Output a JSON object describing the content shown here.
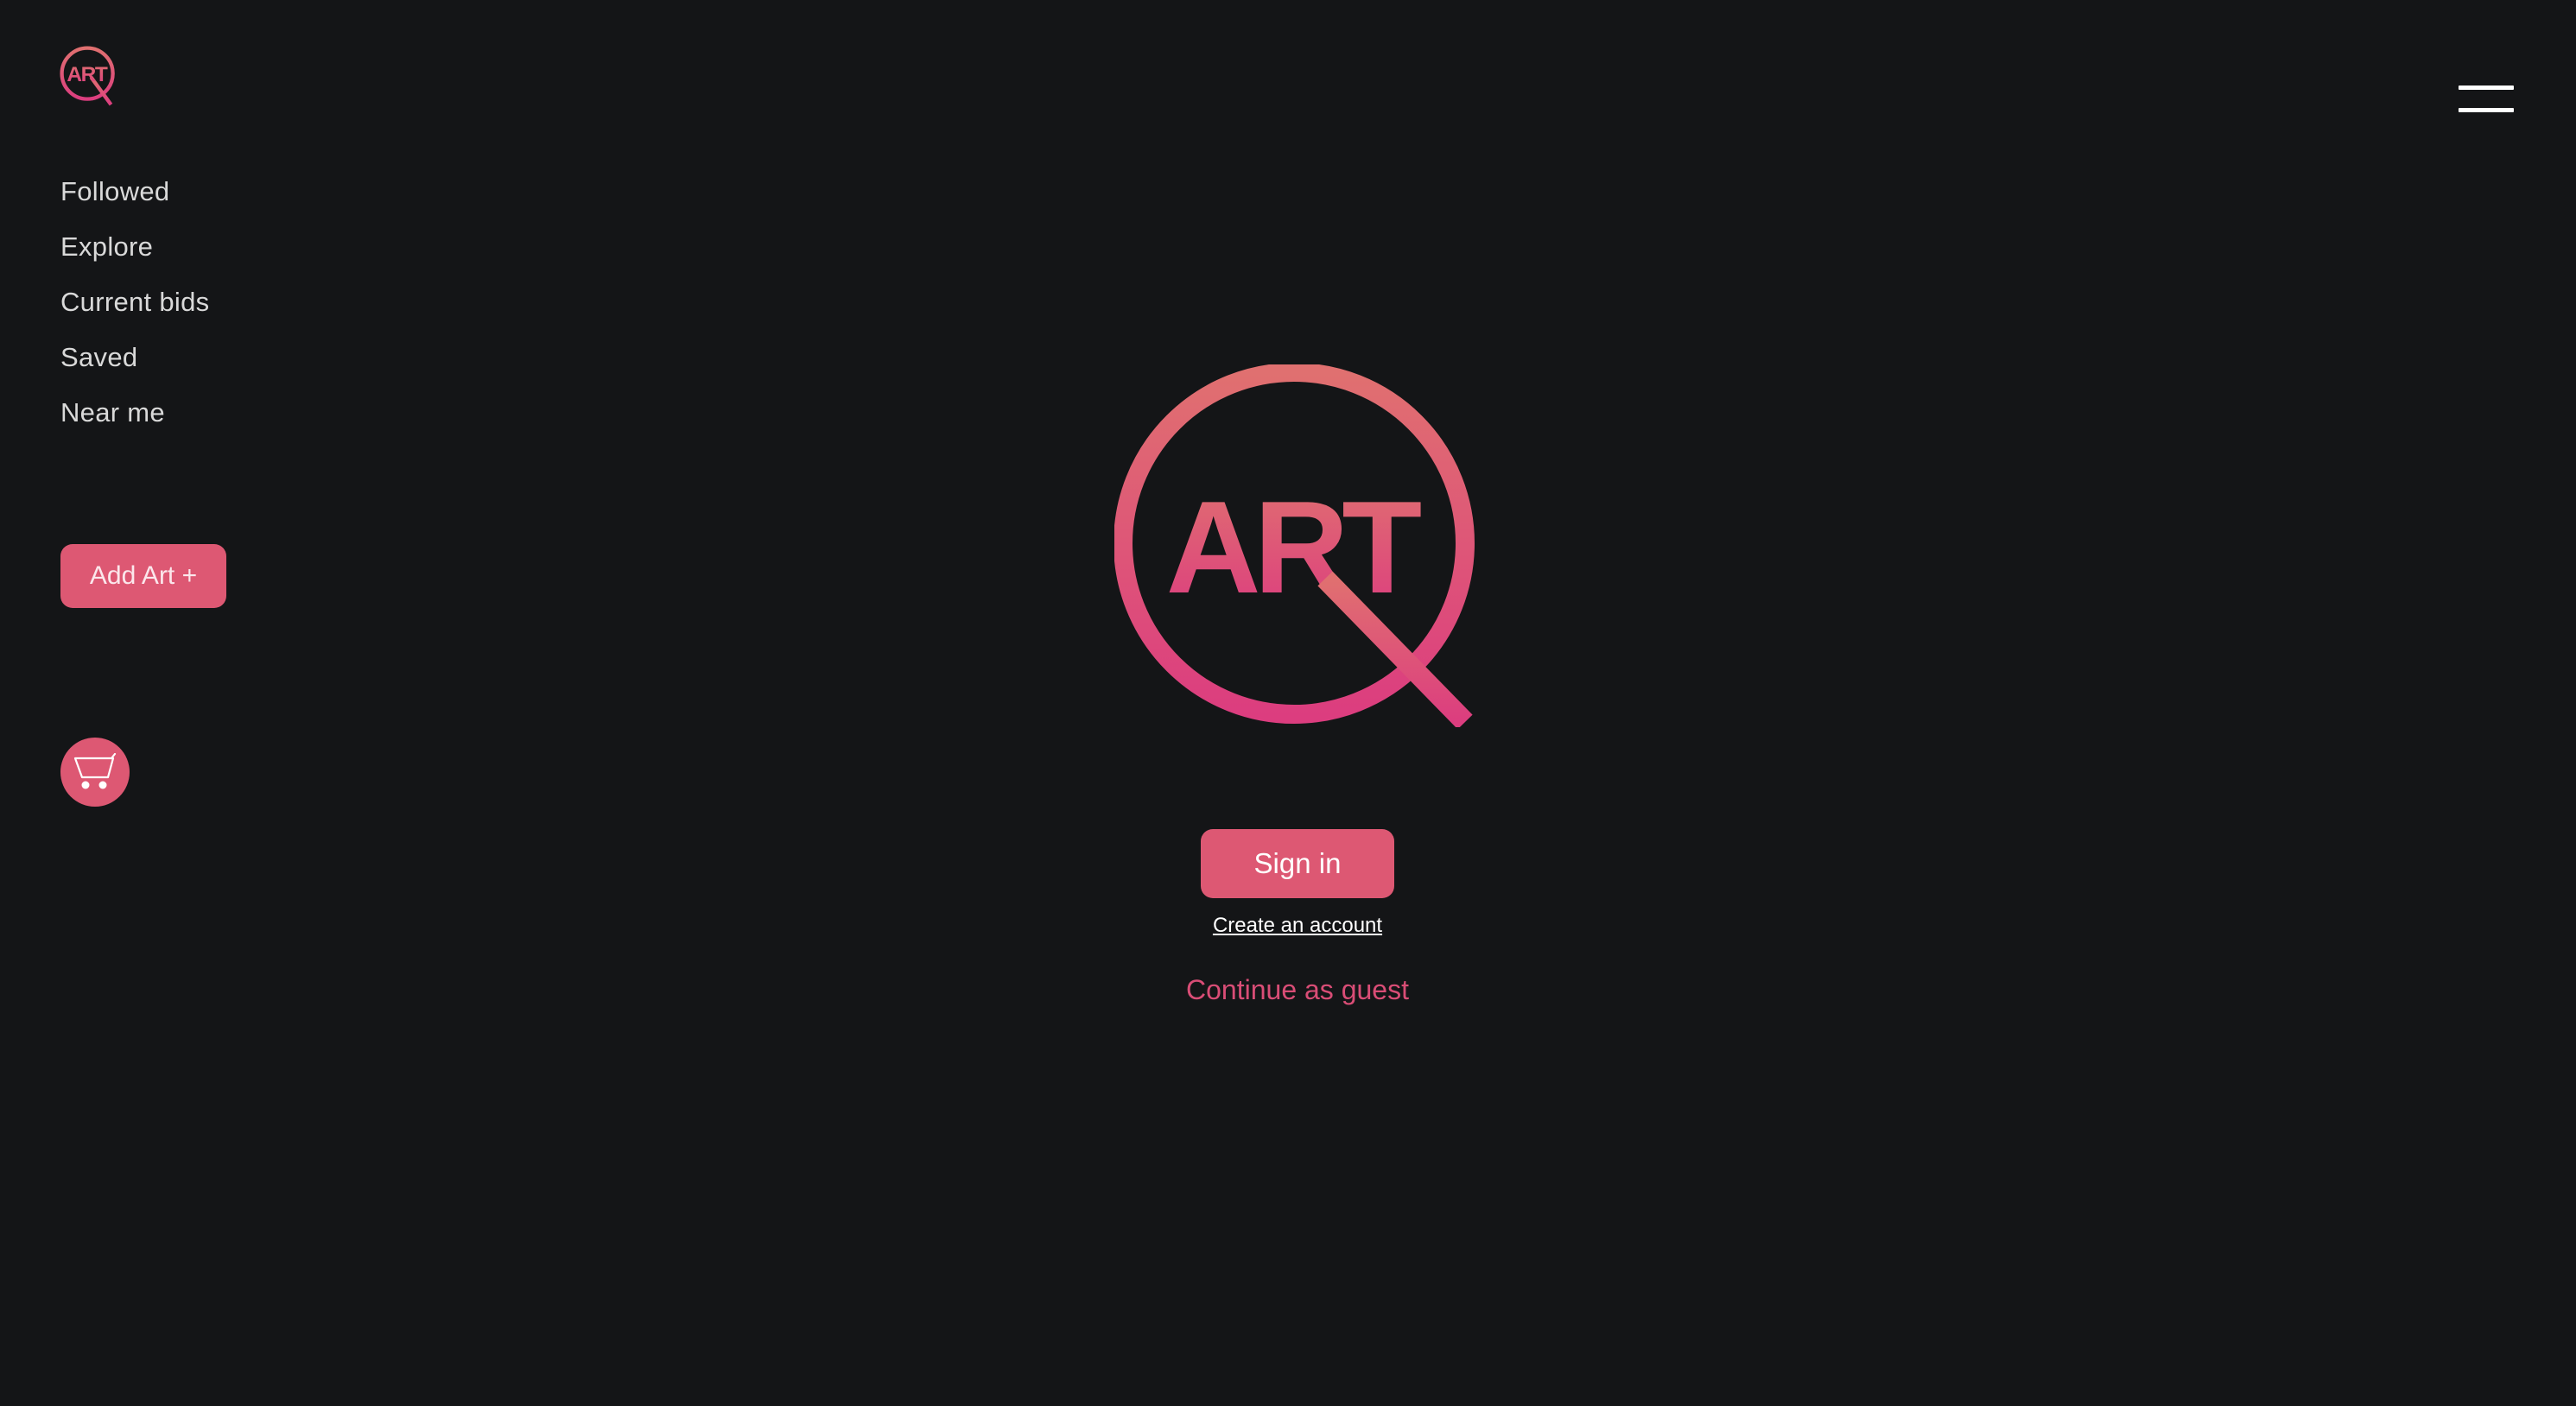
{
  "brand": {
    "logo_text": "ART",
    "colors": {
      "accent": "#dd5873",
      "gradient_top": "#e07070",
      "gradient_bottom": "#dc3d7f",
      "background": "#141517",
      "guest_link": "#d94d76"
    }
  },
  "sidebar": {
    "items": [
      {
        "label": "Followed"
      },
      {
        "label": "Explore"
      },
      {
        "label": "Current bids"
      },
      {
        "label": "Saved"
      },
      {
        "label": "Near me"
      }
    ],
    "add_art_label": "Add Art +",
    "cart_icon": "cart-icon"
  },
  "header": {
    "menu_icon": "hamburger-menu-icon"
  },
  "auth": {
    "sign_in_label": "Sign in",
    "create_account_label": "Create an account",
    "continue_guest_label": "Continue as guest"
  }
}
